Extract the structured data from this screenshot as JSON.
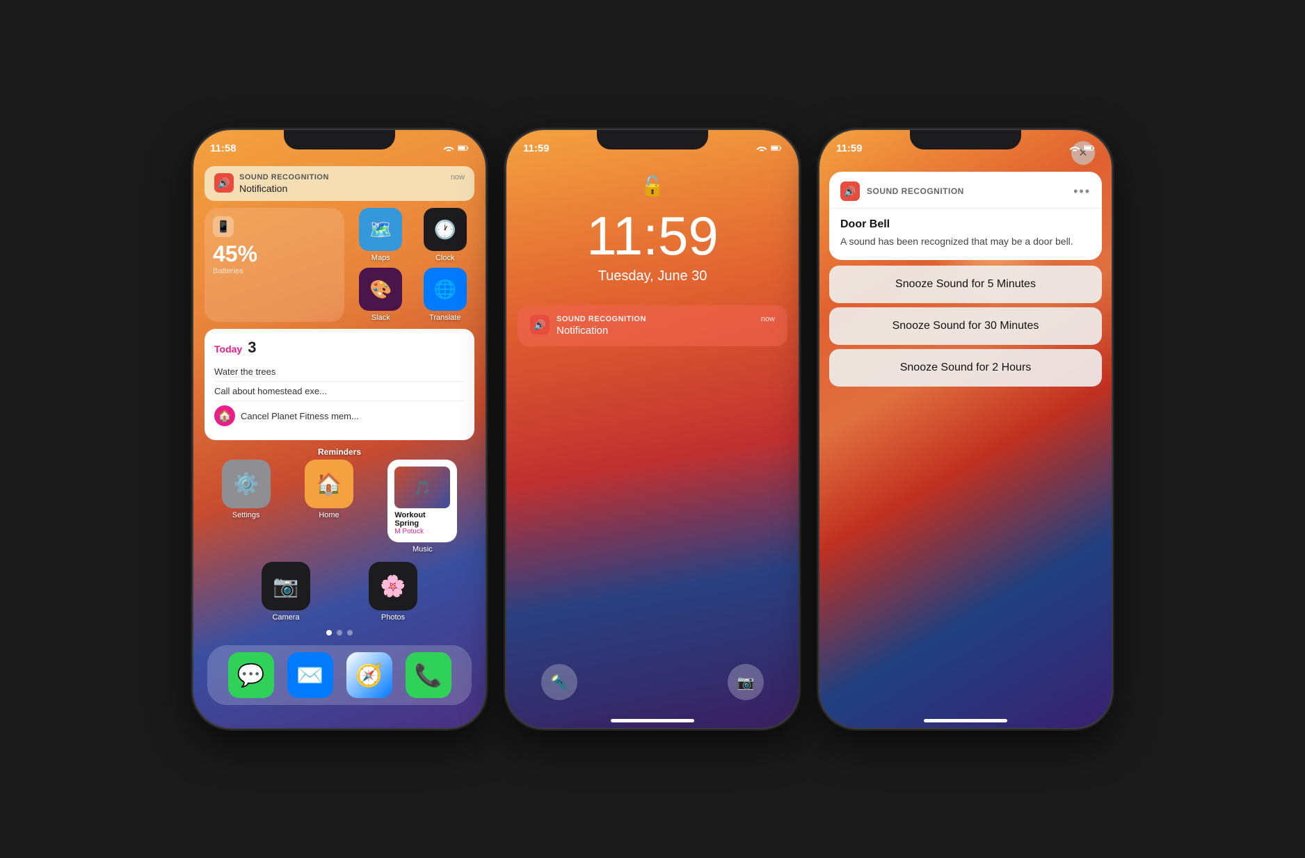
{
  "phone1": {
    "status": {
      "time": "11:58"
    },
    "notification": {
      "app_name": "SOUND RECOGNITION",
      "time": "now",
      "message": "Notification"
    },
    "battery_widget": {
      "label": "Batteries",
      "percent": "45%"
    },
    "apps": [
      {
        "name": "Maps",
        "emoji": "🗺️",
        "bg": "#3498db"
      },
      {
        "name": "Clock",
        "emoji": "🕐",
        "bg": "#1c1c1e"
      },
      {
        "name": "Slack",
        "emoji": "🎨",
        "bg": "#4a154b"
      },
      {
        "name": "Translate",
        "emoji": "🌐",
        "bg": "#007aff"
      }
    ],
    "reminders": {
      "label": "Today",
      "count": "3",
      "items": [
        "Water the trees",
        "Call about homestead exe...",
        "Cancel Planet Fitness mem..."
      ]
    },
    "section_label": "Reminders",
    "grid_apps": [
      {
        "name": "Settings",
        "emoji": "⚙️",
        "bg": "#8e8e93"
      },
      {
        "name": "Home",
        "emoji": "🏠",
        "bg": "#f4a240"
      },
      {
        "name": "Music",
        "emoji": "🎵",
        "bg": "#1c1c1e"
      },
      {
        "name": "Camera",
        "emoji": "📷",
        "bg": "#1c1c1e"
      },
      {
        "name": "Photos",
        "emoji": "🌸",
        "bg": "#1c1c1e"
      }
    ],
    "music": {
      "title": "Workout Spring",
      "artist": "M Potuck"
    },
    "dock": [
      {
        "name": "Messages",
        "emoji": "💬",
        "bg": "#30d158"
      },
      {
        "name": "Mail",
        "emoji": "✉️",
        "bg": "#007aff"
      },
      {
        "name": "Safari",
        "emoji": "🧭",
        "bg": "#007aff"
      },
      {
        "name": "Phone",
        "emoji": "📞",
        "bg": "#30d158"
      }
    ]
  },
  "phone2": {
    "status": {
      "time": "11:59"
    },
    "lock": {
      "time": "11:59",
      "date": "Tuesday, June 30"
    },
    "notification": {
      "app_name": "SOUND RECOGNITION",
      "time": "now",
      "message": "Notification"
    }
  },
  "phone3": {
    "status": {
      "time": "11:59"
    },
    "notification": {
      "app_name": "SOUND RECOGNITION",
      "dots": "•••",
      "title": "Door Bell",
      "description": "A sound has been recognized that may be a door bell."
    },
    "snooze_options": [
      "Snooze Sound for 5 Minutes",
      "Snooze Sound for 30 Minutes",
      "Snooze Sound for 2 Hours"
    ],
    "close_icon": "✕"
  }
}
